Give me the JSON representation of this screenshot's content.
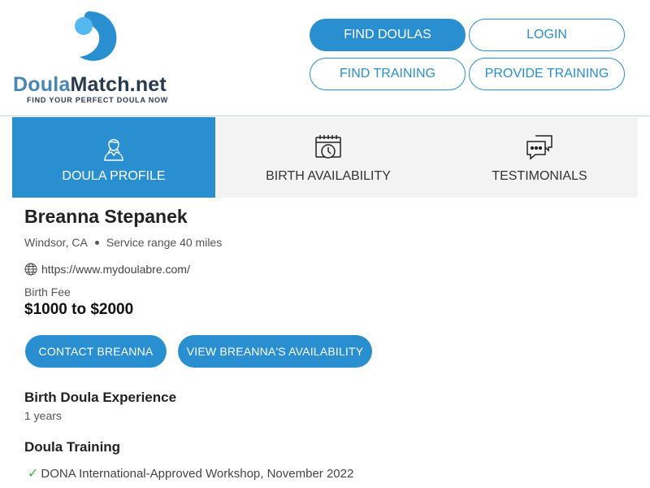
{
  "brand": {
    "name_part1": "Doula",
    "name_part2": "Match.net",
    "tagline": "FIND YOUR PERFECT DOULA NOW",
    "accent": "#2a8fd0"
  },
  "nav": {
    "find_doulas": "FIND DOULAS",
    "login": "LOGIN",
    "find_training": "FIND TRAINING",
    "provide_training": "PROVIDE TRAINING"
  },
  "tabs": [
    {
      "label": "DOULA PROFILE",
      "icon": "doula-person-icon",
      "active": true
    },
    {
      "label": "BIRTH AVAILABILITY",
      "icon": "calendar-clock-icon",
      "active": false
    },
    {
      "label": "TESTIMONIALS",
      "icon": "chat-bubbles-icon",
      "active": false
    }
  ],
  "profile": {
    "name": "Breanna Stepanek",
    "location": "Windsor, CA",
    "service_range": "Service range 40 miles",
    "website": "https://www.mydoulabre.com/",
    "fee_label": "Birth Fee",
    "fee": "$1000 to $2000",
    "contact_button": "CONTACT BREANNA",
    "availability_button": "VIEW BREANNA'S AVAILABILITY",
    "experience_heading": "Birth Doula Experience",
    "experience_value": "1 years",
    "training_heading": "Doula Training",
    "training_items": [
      "DONA International-Approved Workshop, November 2022"
    ]
  }
}
